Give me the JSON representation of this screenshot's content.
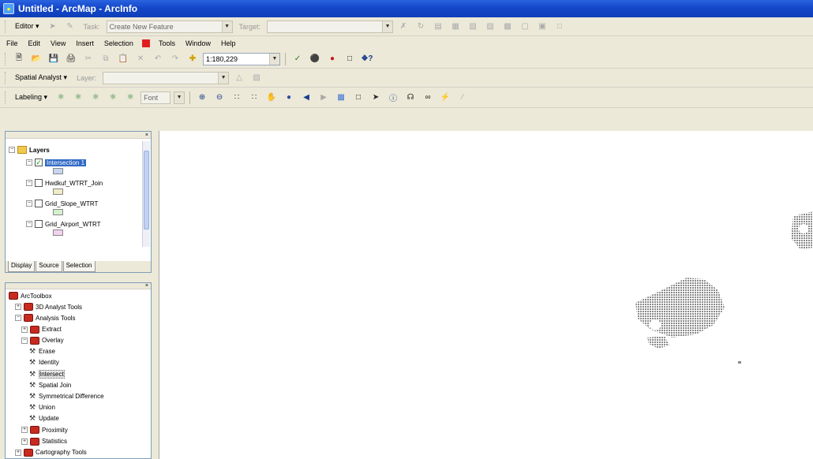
{
  "window": {
    "title": "Untitled - ArcMap - ArcInfo"
  },
  "editor_bar": {
    "editor_label": "Editor ▾",
    "task_value": "Create New Feature",
    "target_label": "Target:",
    "target_value": ""
  },
  "menu": {
    "items": [
      "File",
      "Edit",
      "View",
      "Insert",
      "Selection",
      "Tools",
      "Window",
      "Help"
    ]
  },
  "standard_bar": {
    "scale_value": "1:180,229"
  },
  "spatial_bar": {
    "label": "Spatial Analyst ▾",
    "layer_label": "Layer:",
    "layer_value": ""
  },
  "labeling_bar": {
    "label": "Labeling ▾",
    "font_value": "Font"
  },
  "toc": {
    "root": "Layers",
    "layers": [
      {
        "name": "Intersection 1",
        "checked": true,
        "color": "#c7d6f0"
      },
      {
        "name": "Hwdkuf_WTRT_Join",
        "checked": false,
        "color": "#f1ecc6"
      },
      {
        "name": "Grid_Slope_WTRT",
        "checked": false,
        "color": "#d4f0cc"
      },
      {
        "name": "Grid_Airport_WTRT",
        "checked": false,
        "color": "#f2d2ee"
      }
    ],
    "tabs": [
      "Display",
      "Source",
      "Selection"
    ]
  },
  "toolbox": {
    "items": [
      {
        "label": "ArcToolbox",
        "kind": "root",
        "indent": 0
      },
      {
        "label": "3D Analyst Tools",
        "kind": "toolbox",
        "indent": 1
      },
      {
        "label": "Analysis Tools",
        "kind": "toolbox",
        "indent": 1
      },
      {
        "label": "Extract",
        "kind": "toolset",
        "indent": 2
      },
      {
        "label": "Overlay",
        "kind": "toolset",
        "indent": 2
      },
      {
        "label": "Erase",
        "kind": "tool",
        "indent": 3
      },
      {
        "label": "Identity",
        "kind": "tool",
        "indent": 3
      },
      {
        "label": "Intersect",
        "kind": "tool",
        "indent": 3
      },
      {
        "label": "Spatial Join",
        "kind": "tool",
        "indent": 3
      },
      {
        "label": "Symmetrical Difference",
        "kind": "tool",
        "indent": 3
      },
      {
        "label": "Union",
        "kind": "tool",
        "indent": 3
      },
      {
        "label": "Update",
        "kind": "tool",
        "indent": 3
      },
      {
        "label": "Proximity",
        "kind": "toolset",
        "indent": 2
      },
      {
        "label": "Statistics",
        "kind": "toolset",
        "indent": 2
      },
      {
        "label": "Cartography Tools",
        "kind": "toolbox",
        "indent": 1
      }
    ]
  },
  "colors": {
    "title_blue": "#1447c9",
    "selection": "#316ac5",
    "map_feature": "#8a8a8a"
  }
}
